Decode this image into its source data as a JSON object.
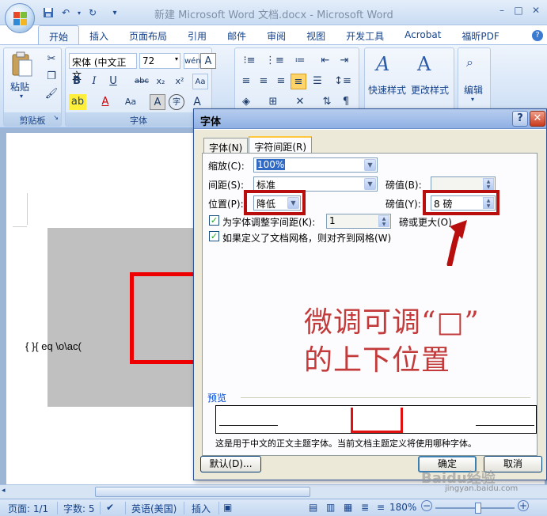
{
  "app": {
    "title": "新建 Microsoft Word 文档.docx - Microsoft Word",
    "window_controls": {
      "minimize": "–",
      "maximize": "□",
      "close": "✕"
    }
  },
  "quick_access": {
    "save_icon": "save-icon",
    "undo_icon": "undo-icon",
    "redo_icon": "redo-icon",
    "customize": "▾"
  },
  "ribbon_tabs": [
    {
      "label": "开始",
      "active": true
    },
    {
      "label": "插入"
    },
    {
      "label": "页面布局"
    },
    {
      "label": "引用"
    },
    {
      "label": "邮件"
    },
    {
      "label": "审阅"
    },
    {
      "label": "视图"
    },
    {
      "label": "开发工具"
    },
    {
      "label": "Acrobat"
    },
    {
      "label": "福昕PDF"
    }
  ],
  "ribbon": {
    "clipboard": {
      "group_label": "剪贴板",
      "paste_label": "粘贴"
    },
    "font": {
      "group_label": "字体",
      "font_name": "宋体 (中文正文",
      "font_size": "72",
      "bold": "B",
      "italic": "I",
      "underline": "U",
      "strike": "abc",
      "subscript": "x₂",
      "superscript": "x²",
      "clear": "Aa",
      "font_color": "A",
      "case": "Aa",
      "char_border": "A",
      "enclose": "字",
      "grow": "A",
      "shrink": "A",
      "phonetic": "wén",
      "border_char": "A"
    },
    "styles": {
      "quick_styles": "快速样式",
      "change_styles": "更改样式"
    },
    "editing": {
      "label": "编辑"
    }
  },
  "document": {
    "field_code": "{   }{ eq \\o\\ac("
  },
  "dialog": {
    "title": "字体",
    "help": "?",
    "close": "✕",
    "tabs": [
      {
        "label": "字体(N)"
      },
      {
        "label": "字符间距(R)",
        "active": true
      }
    ],
    "scale": {
      "label": "缩放(C):",
      "value": "100%"
    },
    "spacing": {
      "label": "间距(S):",
      "value": "标准",
      "pt_label": "磅值(B):",
      "pt_value": ""
    },
    "position": {
      "label": "位置(P):",
      "value": "降低",
      "pt_label": "磅值(Y):",
      "pt_value": "8 磅"
    },
    "kerning": {
      "label": "为字体调整字间距(K):",
      "value": "1",
      "suffix": "磅或更大(O)",
      "checked": true
    },
    "grid": {
      "label": "如果定义了文档网格，则对齐到网格(W)",
      "checked": true
    },
    "annotation_line1": "微调可调“□”",
    "annotation_line2": "的上下位置",
    "preview_label": "预览",
    "preview_caption": "这是用于中文的正文主题字体。当前文档主题定义将使用哪种字体。",
    "buttons": {
      "default": "默认(D)...",
      "ok": "确定",
      "cancel": "取消"
    }
  },
  "statusbar": {
    "page": "页面: 1/1",
    "words": "字数: 5",
    "language": "英语(美国)",
    "mode": "插入",
    "zoom": "180%",
    "zoom_minus": "−",
    "zoom_plus": "+"
  },
  "watermark": {
    "text": "Baidu经验",
    "url": "jingyan.baidu.com"
  },
  "colors": {
    "annotation_red": "#b80e0e",
    "ribbon_blue": "#15428b",
    "dialog_bg": "#ece9d8"
  }
}
